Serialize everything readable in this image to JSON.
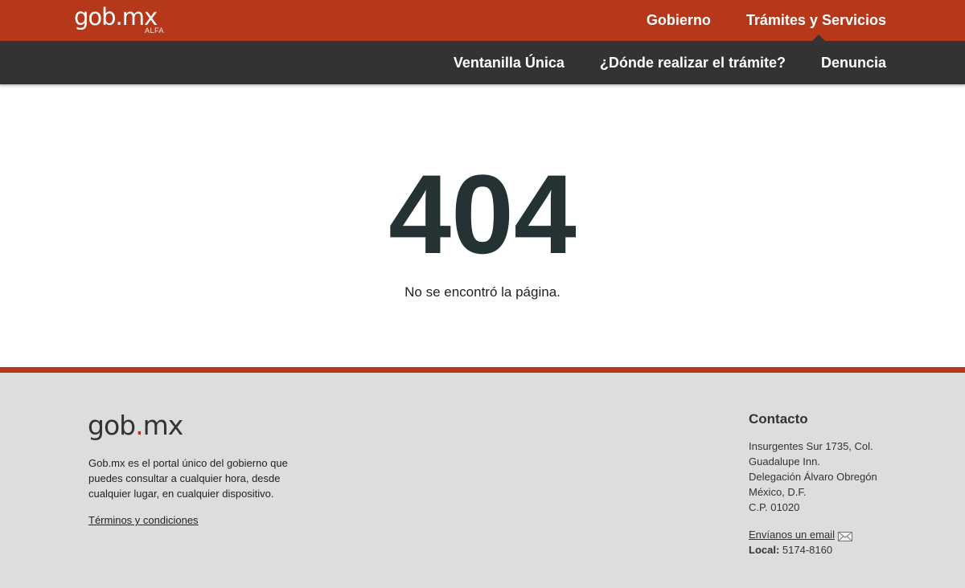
{
  "header": {
    "logo": "gob.mx",
    "logo_badge": "ALFA",
    "top_nav": [
      "Gobierno",
      "Trámites y Servicios"
    ],
    "sub_nav": [
      "Ventanilla Única",
      "¿Dónde realizar el trámite?",
      "Denuncia"
    ]
  },
  "error": {
    "code": "404",
    "message": "No se encontró la página."
  },
  "footer": {
    "logo_left": "gob",
    "logo_dot": ".",
    "logo_right": "mx",
    "description": "Gob.mx es el portal único del gobierno que puedes consultar a cualquier hora, desde cualquier lugar, en cualquier dispositivo.",
    "terms_link": "Términos y condiciones",
    "contact": {
      "title": "Contacto",
      "address_lines": [
        "Insurgentes Sur 1735, Col.",
        "Guadalupe Inn.",
        "Delegación Álvaro Obregón",
        "México, D.F.",
        "C.P. 01020"
      ],
      "email_link": "Envíanos un email",
      "email_icon": "envelope-icon",
      "phone_label": "Local:",
      "phone_value": "5174-8160"
    }
  },
  "colors": {
    "brand_red": "#b5381b",
    "subbar": "#333333",
    "footer_bg": "#dddddd",
    "error_code": "#253233"
  }
}
